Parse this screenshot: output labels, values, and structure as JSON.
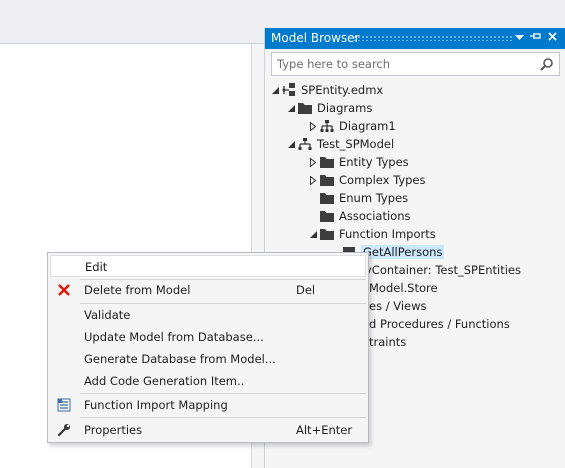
{
  "model_browser": {
    "title": "Model Browser",
    "search_placeholder": "Type here to search",
    "tree": [
      {
        "label": "SPEntity.edmx"
      },
      {
        "label": "Diagrams"
      },
      {
        "label": "Diagram1"
      },
      {
        "label": "Test_SPModel"
      },
      {
        "label": "Entity Types"
      },
      {
        "label": "Complex Types"
      },
      {
        "label": "Enum Types"
      },
      {
        "label": "Associations"
      },
      {
        "label": "Function Imports"
      },
      {
        "label": "GetAllPersons"
      },
      {
        "label": "yContainer: Test_SPEntities"
      },
      {
        "label": "Model.Store"
      },
      {
        "label": "es / Views"
      },
      {
        "label": "d Procedures / Functions"
      },
      {
        "label": "traints"
      }
    ]
  },
  "context_menu": {
    "items": [
      {
        "label": "Edit",
        "shortcut": ""
      },
      {
        "label": "Delete from Model",
        "shortcut": "Del"
      },
      {
        "label": "Validate",
        "shortcut": ""
      },
      {
        "label": "Update Model from Database...",
        "shortcut": ""
      },
      {
        "label": "Generate Database from Model...",
        "shortcut": ""
      },
      {
        "label": "Add Code Generation Item..",
        "shortcut": ""
      },
      {
        "label": "Function Import Mapping",
        "shortcut": ""
      },
      {
        "label": "Properties",
        "shortcut": "Alt+Enter"
      }
    ]
  },
  "colors": {
    "accent": "#007acc",
    "selection": "#cce8fb",
    "delete_icon": "#e51400"
  }
}
